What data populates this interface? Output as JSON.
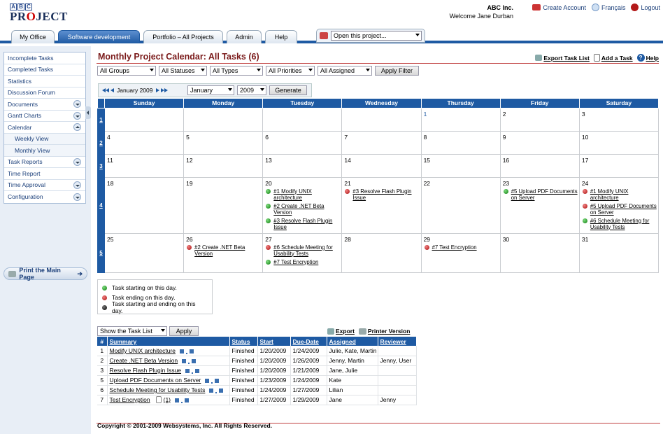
{
  "header": {
    "logo_top": "ABC",
    "logo_project_pre": "PR",
    "logo_project_o": "O",
    "logo_project_post": "JECT",
    "company": "ABC Inc.",
    "welcome": "Welcome Jane Durban",
    "create_account": "Create Account",
    "language": "Français",
    "logout": "Logout"
  },
  "tabs": [
    "My Office",
    "Software development",
    "Portfolio – All Projects",
    "Admin",
    "Help"
  ],
  "open_project": "Open this project...",
  "sidebar": {
    "items": [
      {
        "label": "Incomplete Tasks"
      },
      {
        "label": "Completed Tasks"
      },
      {
        "label": "Statistics"
      },
      {
        "label": "Discussion Forum"
      },
      {
        "label": "Documents"
      },
      {
        "label": "Gantt Charts"
      },
      {
        "label": "Calendar"
      },
      {
        "label": "Weekly View"
      },
      {
        "label": "Monthly View"
      },
      {
        "label": "Task Reports"
      },
      {
        "label": "Time Report"
      },
      {
        "label": "Time Approval"
      },
      {
        "label": "Configuration"
      }
    ],
    "print": "Print the Main Page"
  },
  "page": {
    "title": "Monthly Project Calendar: All Tasks (6)",
    "export_task_list": "Export Task List",
    "add_task": "Add a Task",
    "help": "Help"
  },
  "filters": {
    "groups": "All Groups",
    "statuses": "All Statuses",
    "types": "All Types",
    "priorities": "All Priorities",
    "assigned": "All Assigned",
    "apply": "Apply Filter"
  },
  "generator": {
    "current": "January 2009",
    "month": "January",
    "year": "2009",
    "generate": "Generate"
  },
  "calendar": {
    "days": [
      "Sunday",
      "Monday",
      "Tuesday",
      "Wednesday",
      "Thursday",
      "Friday",
      "Saturday"
    ],
    "weeks": [
      "1",
      "2",
      "3",
      "4",
      "5"
    ],
    "dates": [
      [
        "",
        "",
        "",
        "",
        "1",
        "2",
        "3"
      ],
      [
        "4",
        "5",
        "6",
        "7",
        "8",
        "9",
        "10"
      ],
      [
        "11",
        "12",
        "13",
        "14",
        "15",
        "16",
        "17"
      ],
      [
        "18",
        "19",
        "20",
        "21",
        "22",
        "23",
        "24"
      ],
      [
        "25",
        "26",
        "27",
        "28",
        "29",
        "30",
        "31"
      ]
    ],
    "events": {
      "w4d2": [
        {
          "c": "g",
          "t": "#1 Modify UNIX architecture"
        },
        {
          "c": "g",
          "t": "#2 Create .NET Beta Version"
        },
        {
          "c": "g",
          "t": "#3 Resolve Flash Plugin Issue"
        }
      ],
      "w4d3": [
        {
          "c": "r",
          "t": "#3 Resolve Flash Plugin Issue"
        }
      ],
      "w4d5": [
        {
          "c": "g",
          "t": "#5 Upload PDF Documents on Server"
        }
      ],
      "w4d6": [
        {
          "c": "r",
          "t": "#1 Modify UNIX architecture"
        },
        {
          "c": "r",
          "t": "#5 Upload PDF Documents on Server"
        },
        {
          "c": "g",
          "t": "#6 Schedule Meeting for Usability Tests"
        }
      ],
      "w5d1": [
        {
          "c": "r",
          "t": "#2 Create .NET Beta Version"
        }
      ],
      "w5d2": [
        {
          "c": "r",
          "t": "#6 Schedule Meeting for Usability Tests"
        },
        {
          "c": "g",
          "t": "#7 Test Encryption"
        }
      ],
      "w5d4": [
        {
          "c": "r",
          "t": "#7 Test Encryption"
        }
      ]
    }
  },
  "legend": [
    {
      "c": "g",
      "t": "Task starting on this day."
    },
    {
      "c": "r",
      "t": "Task ending on this day."
    },
    {
      "c": "k",
      "t": "Task starting and ending on this day."
    }
  ],
  "tasklist": {
    "show": "Show the Task List",
    "apply": "Apply",
    "export": "Export",
    "printer": "Printer Version",
    "headers": [
      "#",
      "Summary",
      "Status",
      "Start",
      "Due-Date",
      "Assigned",
      "Reviewer"
    ],
    "rows": [
      [
        "1",
        "Modify UNIX architecture",
        "Finished",
        "1/20/2009",
        "1/24/2009",
        "Julie, Kate, Martin",
        ""
      ],
      [
        "2",
        "Create .NET Beta Version",
        "Finished",
        "1/20/2009",
        "1/26/2009",
        "Jenny, Martin",
        "Jenny, User"
      ],
      [
        "3",
        "Resolve Flash Plugin Issue",
        "Finished",
        "1/20/2009",
        "1/21/2009",
        "Jane, Julie",
        ""
      ],
      [
        "5",
        "Upload PDF Documents on Server",
        "Finished",
        "1/23/2009",
        "1/24/2009",
        "Kate",
        ""
      ],
      [
        "6",
        "Schedule Meeting for Usability Tests",
        "Finished",
        "1/24/2009",
        "1/27/2009",
        "Lilian",
        ""
      ],
      [
        "7",
        "Test Encryption",
        "Finished",
        "1/27/2009",
        "1/29/2009",
        "Jane",
        "Jenny"
      ]
    ],
    "attach_count": "(1)"
  },
  "footer": "Copyright © 2001-2009 Websystems, Inc. All Rights Reserved."
}
